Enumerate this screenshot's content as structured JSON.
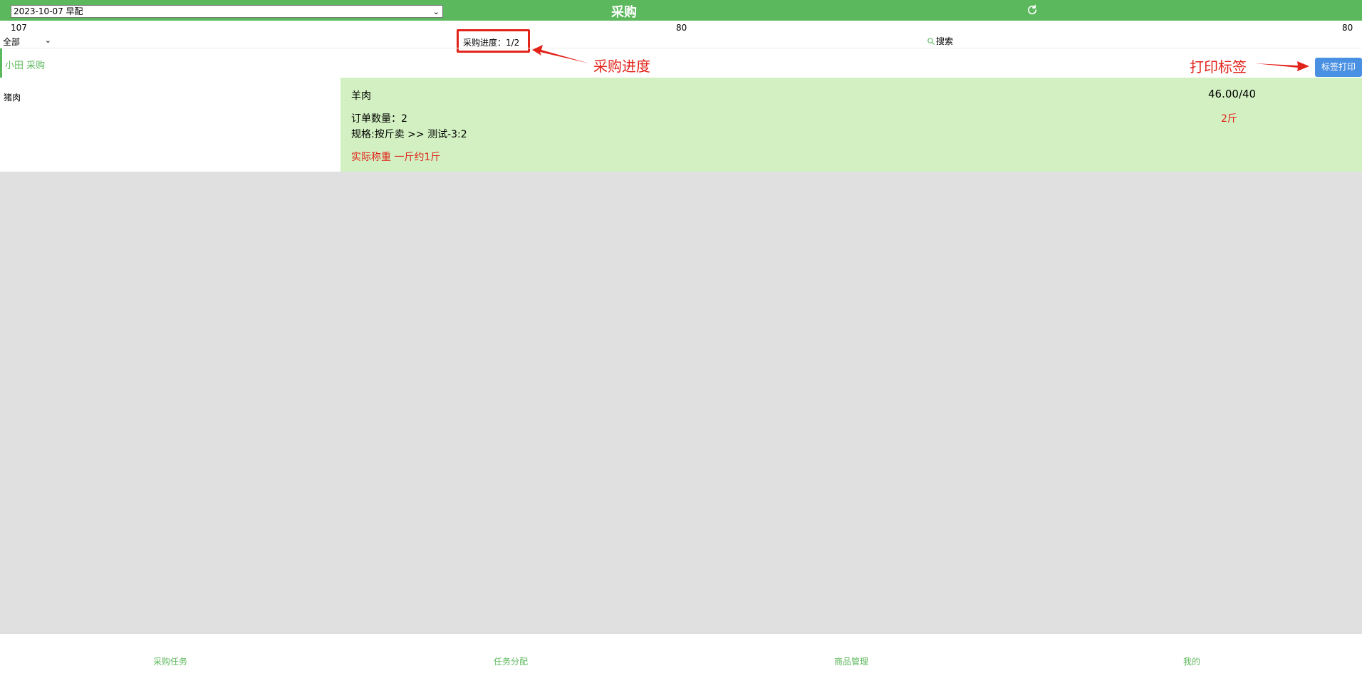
{
  "header": {
    "date_select": "2023-10-07 早配",
    "title": "采购"
  },
  "counts": {
    "left": "107",
    "middle": "80",
    "right": "80"
  },
  "filter": {
    "category_select": "全部",
    "progress": "采购进度：1/2",
    "search_label": "搜索"
  },
  "buyer": {
    "name": "小田 采购",
    "print_button": "标签打印"
  },
  "annotations": {
    "progress_note": "采购进度",
    "print_note": "打印标签"
  },
  "categories": [
    "猪肉"
  ],
  "product": {
    "name": "羊肉",
    "order_qty": "订单数量：2",
    "spec": "规格:按斤卖 >> 测试-3:2",
    "actual_weight": "实际称重 一斤约1斤",
    "price": "46.00/40",
    "unit": "2斤"
  },
  "bottom_nav": [
    "采购任务",
    "任务分配",
    "商品管理",
    "我的"
  ],
  "colors": {
    "brand_green": "#5cb85c",
    "highlight_red": "#e2231a",
    "button_blue": "#4a90e2",
    "card_green": "#d2f0c1"
  },
  "icons": {
    "refresh": "refresh-icon",
    "search": "search-icon"
  }
}
